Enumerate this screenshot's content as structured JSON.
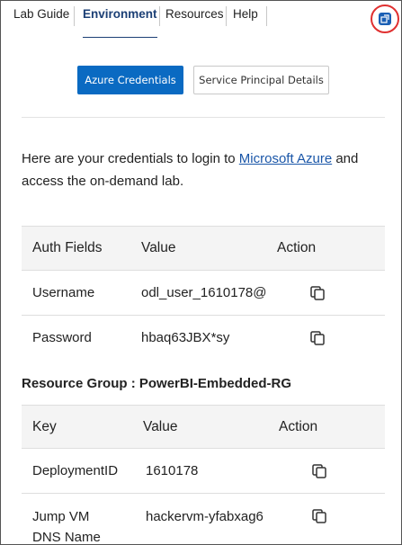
{
  "tabs": [
    {
      "label": "Lab Guide",
      "active": false
    },
    {
      "label": "Environment",
      "active": true
    },
    {
      "label": "Resources",
      "active": false
    },
    {
      "label": "Help",
      "active": false
    }
  ],
  "buttons": {
    "azure_credentials": "Azure Credentials",
    "service_principal": "Service Principal Details"
  },
  "intro": {
    "before": "Here are your credentials to login to ",
    "link": "Microsoft Azure",
    "after": " and access the on-demand lab."
  },
  "credentials_table": {
    "headers": [
      "Auth Fields",
      "Value",
      "Action"
    ],
    "rows": [
      {
        "field": "Username",
        "value": "odl_user_1610178@"
      },
      {
        "field": "Password",
        "value": "hbaq63JBX*sy"
      }
    ]
  },
  "resource_group": {
    "label": "Resource Group : PowerBI-Embedded-RG"
  },
  "resource_table": {
    "headers": [
      "Key",
      "Value",
      "Action"
    ],
    "rows": [
      {
        "key": "DeploymentID",
        "value": "1610178"
      },
      {
        "key": "Jump VM DNS Name",
        "key_line1": "Jump VM",
        "key_line2": "DNS Name",
        "value": "hackervm-yfabxag6"
      }
    ]
  },
  "colors": {
    "accent": "#0a6ac2",
    "active_tab": "#1b3f75",
    "link": "#1a56a8",
    "highlight_circle": "#e03030"
  },
  "icons": {
    "copy": "copy-icon",
    "popout": "popout-icon"
  }
}
